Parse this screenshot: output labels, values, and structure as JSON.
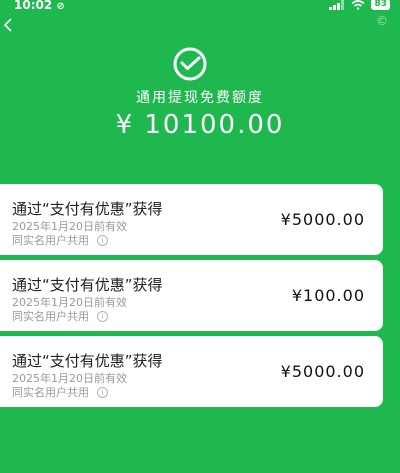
{
  "status_bar": {
    "time": "10:02",
    "battery": "83"
  },
  "header": {
    "title": "通用提现免费额度",
    "amount": "¥ 10100.00"
  },
  "cards": [
    {
      "title": "通过“支付有优惠”获得",
      "date": "2025年1月20日前有效",
      "note": "同实名用户共用",
      "amount": "¥5000.00"
    },
    {
      "title": "通过“支付有优惠”获得",
      "date": "2025年1月20日前有效",
      "note": "同实名用户共用",
      "amount": "¥100.00"
    },
    {
      "title": "通过“支付有优惠”获得",
      "date": "2025年1月20日前有效",
      "note": "同实名用户共用",
      "amount": "¥5000.00"
    }
  ],
  "colors": {
    "background": "#1fb84f",
    "card": "#ffffff",
    "secondary_text": "#9a9a9a"
  },
  "icons": [
    "back-icon",
    "wechat-pay-logo-icon",
    "info-icon",
    "signal-icon",
    "wifi-icon",
    "battery-icon",
    "mute-icon"
  ]
}
